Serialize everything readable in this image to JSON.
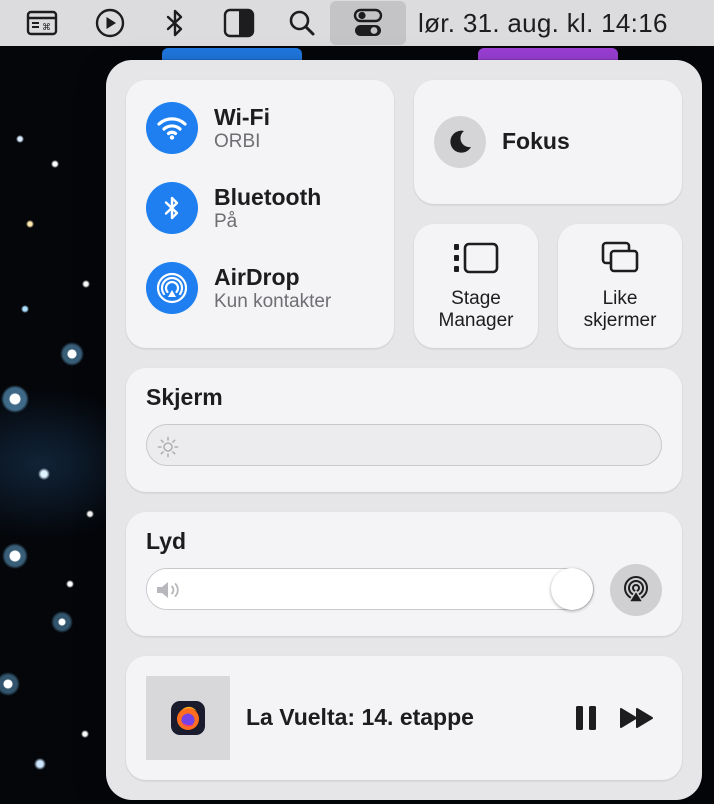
{
  "menubar": {
    "clock": "lør. 31. aug. kl. 14:16",
    "icons": [
      "app-menu-icon",
      "play-circle-icon",
      "bluetooth-icon",
      "contrast-icon",
      "search-icon",
      "control-center-icon"
    ]
  },
  "connectivity": {
    "wifi": {
      "title": "Wi-Fi",
      "subtitle": "ORBI"
    },
    "bluetooth": {
      "title": "Bluetooth",
      "subtitle": "På"
    },
    "airdrop": {
      "title": "AirDrop",
      "subtitle": "Kun kontakter"
    }
  },
  "focus": {
    "label": "Fokus"
  },
  "stage_manager": {
    "line1": "Stage",
    "line2": "Manager"
  },
  "mirroring": {
    "line1": "Like",
    "line2": "skjermer"
  },
  "display": {
    "title": "Skjerm",
    "brightness": 0
  },
  "sound": {
    "title": "Lyd",
    "volume": 1.0
  },
  "now_playing": {
    "title": "La Vuelta: 14. etappe"
  },
  "colors": {
    "accent": "#1f7ff0",
    "panel": "#e6e6e8",
    "card": "#f4f4f6"
  }
}
